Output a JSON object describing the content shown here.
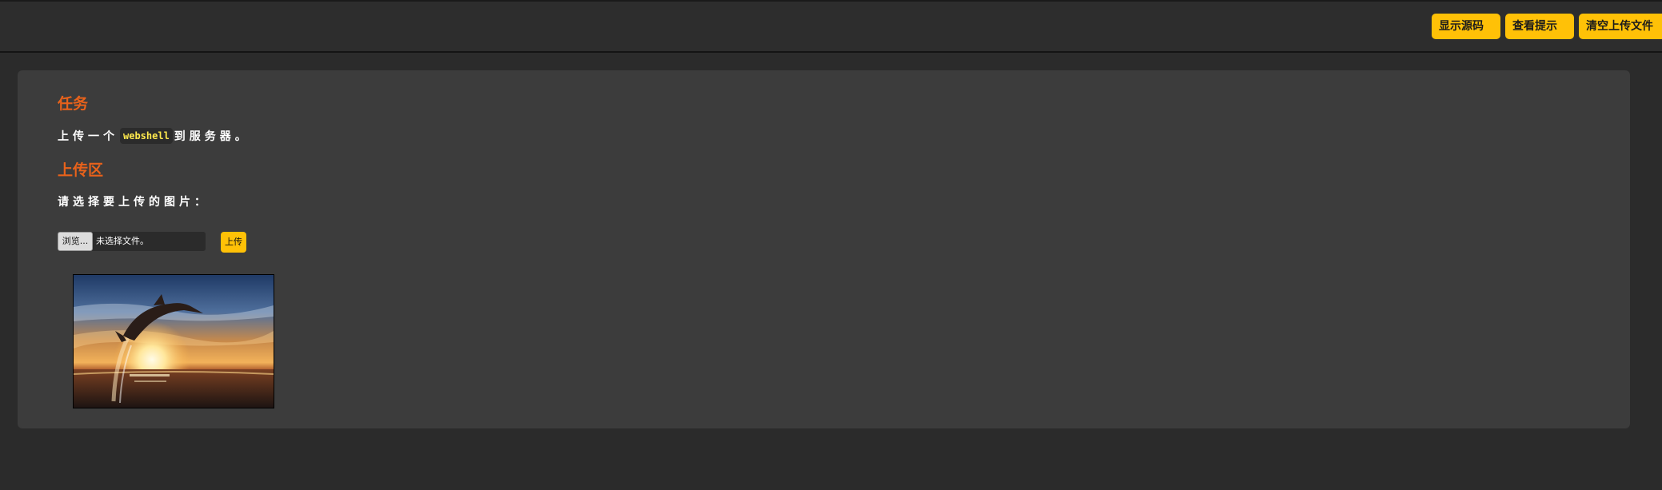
{
  "toolbar": {
    "show_source": "显示源码",
    "view_hint": "查看提示",
    "clear_uploads": "清空上传文件"
  },
  "task": {
    "heading": "任务",
    "text_before": "上传一个",
    "code": "webshell",
    "text_after": "到服务器。"
  },
  "upload": {
    "heading": "上传区",
    "prompt": "请选择要上传的图片：",
    "browse_label": "浏览...",
    "file_status": "未选择文件。",
    "submit_label": "上传"
  },
  "colors": {
    "accent": "#ffc107",
    "heading": "#e8621b",
    "code_text": "#ffe94d"
  }
}
